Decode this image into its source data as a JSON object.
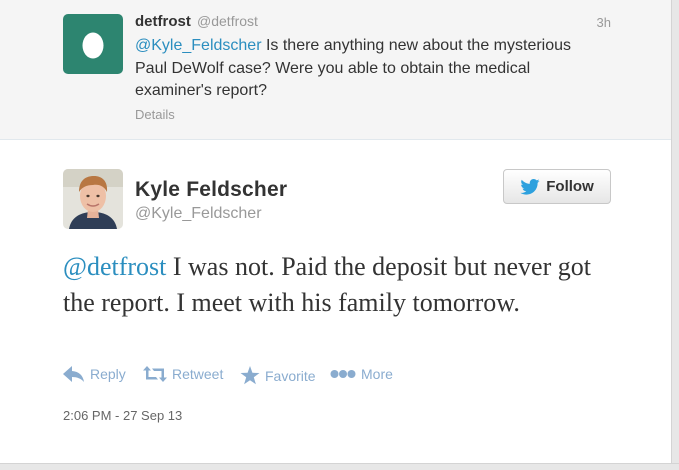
{
  "reply_tweet": {
    "name": "detfrost",
    "handle": "@detfrost",
    "time": "3h",
    "mention": "@Kyle_Feldscher",
    "text": " Is there anything new about the mysterious Paul DeWolf case? Were you able to obtain the medical examiner's report?",
    "details_label": "Details"
  },
  "main_tweet": {
    "name": "Kyle Feldscher",
    "handle": "@Kyle_Feldscher",
    "follow_label": "Follow",
    "mention": "@detfrost",
    "text": " I was not. Paid the deposit but never got the report. I meet with his family tomorrow.",
    "actions": {
      "reply": "Reply",
      "retweet": "Retweet",
      "favorite": "Favorite",
      "more": "More"
    },
    "timestamp": "2:06 PM - 27 Sep 13"
  },
  "colors": {
    "link": "#2b8ebf",
    "action": "#8aaccf",
    "egg_avatar": "#2d8570"
  },
  "icons": [
    "egg-icon",
    "bird-icon",
    "reply-icon",
    "retweet-icon",
    "favorite-star-icon",
    "more-dots-icon"
  ]
}
